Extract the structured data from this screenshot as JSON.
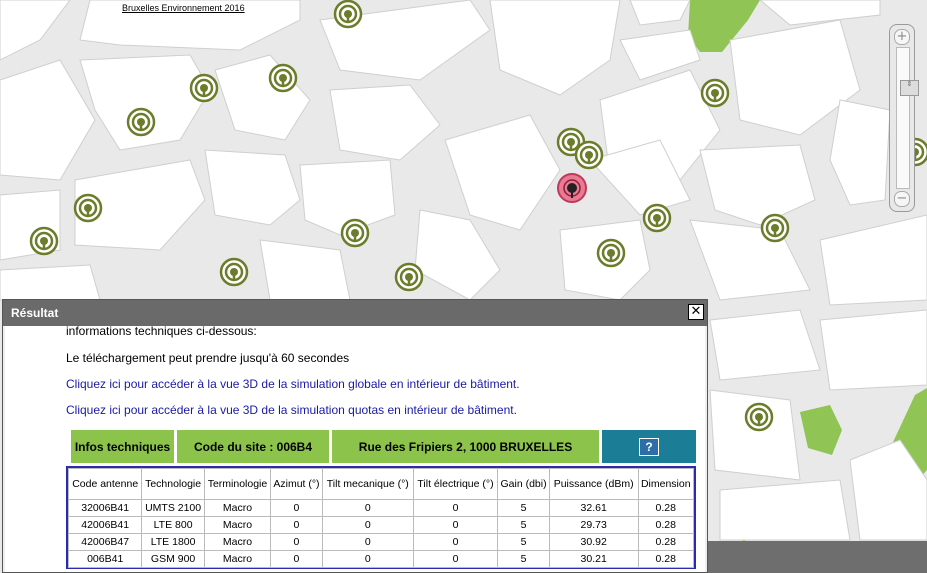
{
  "map": {
    "attribution": "Bruxelles Environnement 2016",
    "zoom": {
      "plus_label": "+",
      "minus_label": "−",
      "thumb_label": "⇕"
    }
  },
  "colors": {
    "antenna": "#6b7d2a",
    "selected_antenna": "#d9486a",
    "park": "#90c455",
    "dialog_title": "#6a6a6a",
    "info_green": "#8cc34a",
    "help_teal": "#1b7d96",
    "link": "#1a1aa6",
    "table_border": "#2b2bb0"
  },
  "dialog": {
    "title": "Résultat",
    "close_label": "✕",
    "truncated_line": "informations techniques ci-dessous:",
    "download_note": "Le téléchargement peut prendre jusqu'à 60 secondes",
    "link_global": "Cliquez ici pour accéder à la vue 3D de la simulation globale en intérieur de bâtiment.",
    "link_quotas": "Cliquez ici pour accéder à la vue 3D de la simulation quotas en intérieur de bâtiment.",
    "header": {
      "infos": "Infos techniques",
      "site_code": "Code du site : 006B4",
      "address": "Rue des Fripiers 2, 1000 BRUXELLES",
      "help_icon": "?"
    },
    "table": {
      "columns": [
        "Code antenne",
        "Technologie",
        "Terminologie",
        "Azimut (°)",
        "Tilt mecanique (°)",
        "Tilt électrique (°)",
        "Gain (dbi)",
        "Puissance (dBm)",
        "Dimension"
      ],
      "rows": [
        [
          "32006B41",
          "UMTS 2100",
          "Macro",
          "0",
          "0",
          "0",
          "5",
          "32.61",
          "0.28"
        ],
        [
          "42006B41",
          "LTE 800",
          "Macro",
          "0",
          "0",
          "0",
          "5",
          "29.73",
          "0.28"
        ],
        [
          "42006B47",
          "LTE 1800",
          "Macro",
          "0",
          "0",
          "0",
          "5",
          "30.92",
          "0.28"
        ],
        [
          "006B41",
          "GSM 900",
          "Macro",
          "0",
          "0",
          "0",
          "5",
          "30.21",
          "0.28"
        ]
      ]
    }
  }
}
